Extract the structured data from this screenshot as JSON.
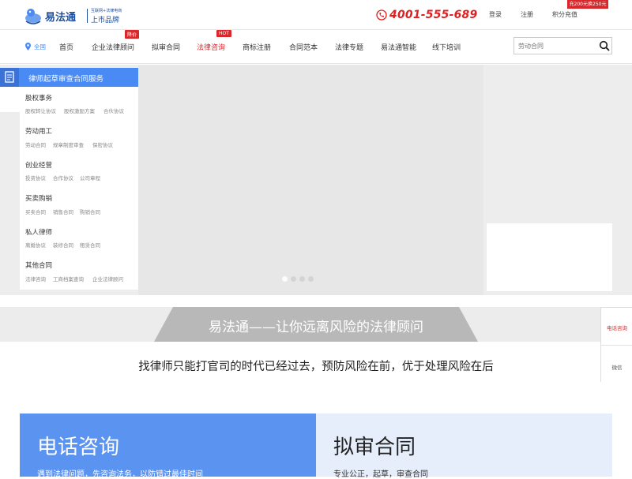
{
  "header": {
    "brand": "易法通",
    "brand_sub1": "互联网+法律电商",
    "brand_sub2": "上市品牌",
    "phone": "4001-555-689",
    "links": [
      "登录",
      "注册",
      "积分充值"
    ],
    "promo_badge": "充200元换250元"
  },
  "nav": {
    "location": "全国",
    "items": [
      {
        "label": "首页"
      },
      {
        "label": "企业法律顾问",
        "badge": "降价"
      },
      {
        "label": "拟审合同"
      },
      {
        "label": "法律咨询",
        "badge": "HOT",
        "hot": true
      },
      {
        "label": "商标注册"
      },
      {
        "label": "合同范本"
      },
      {
        "label": "法律专题"
      },
      {
        "label": "易法通智能"
      },
      {
        "label": "线下培训"
      }
    ],
    "search_placeholder": "劳动合同"
  },
  "menu": {
    "header": "律师起草审查合同服务",
    "categories": [
      {
        "title": "股权事务",
        "subs": [
          "股权转让协议",
          "股权激励方案",
          "合伙协议"
        ]
      },
      {
        "title": "劳动用工",
        "subs": [
          "劳动合同",
          "规章制度审查",
          "保密协议"
        ]
      },
      {
        "title": "创业经营",
        "subs": [
          "投资协议",
          "合作协议",
          "公司章程"
        ]
      },
      {
        "title": "买卖购销",
        "subs": [
          "买卖合同",
          "销售合同",
          "购销合同"
        ]
      },
      {
        "title": "私人律师",
        "subs": [
          "离婚协议",
          "装修合同",
          "租赁合同"
        ]
      },
      {
        "title": "其他合同",
        "subs": [
          "法律咨询",
          "工商档案查询",
          "企业法律顾问"
        ]
      }
    ]
  },
  "carousel": {
    "slides": 4,
    "active": 0
  },
  "band": {
    "title": "易法通——让你远离风险的法律顾问"
  },
  "tagline": "找律师只能打官司的时代已经过去，预防风险在前，优于处理风险在后",
  "side_widget": {
    "phone_consult": "电话咨询",
    "wechat": "微信"
  },
  "cards": [
    {
      "title": "电话咨询",
      "subtitle": "遇到法律问题，先咨询法务，以防错过最佳时间"
    },
    {
      "title": "拟审合同",
      "subtitle": "专业公正，起草，审查合同"
    }
  ],
  "colors": {
    "accent_blue": "#4a8af4",
    "brand_navy": "#1d4e9e",
    "hot_red": "#d9282b",
    "band_gray": "#b8b8b8"
  }
}
